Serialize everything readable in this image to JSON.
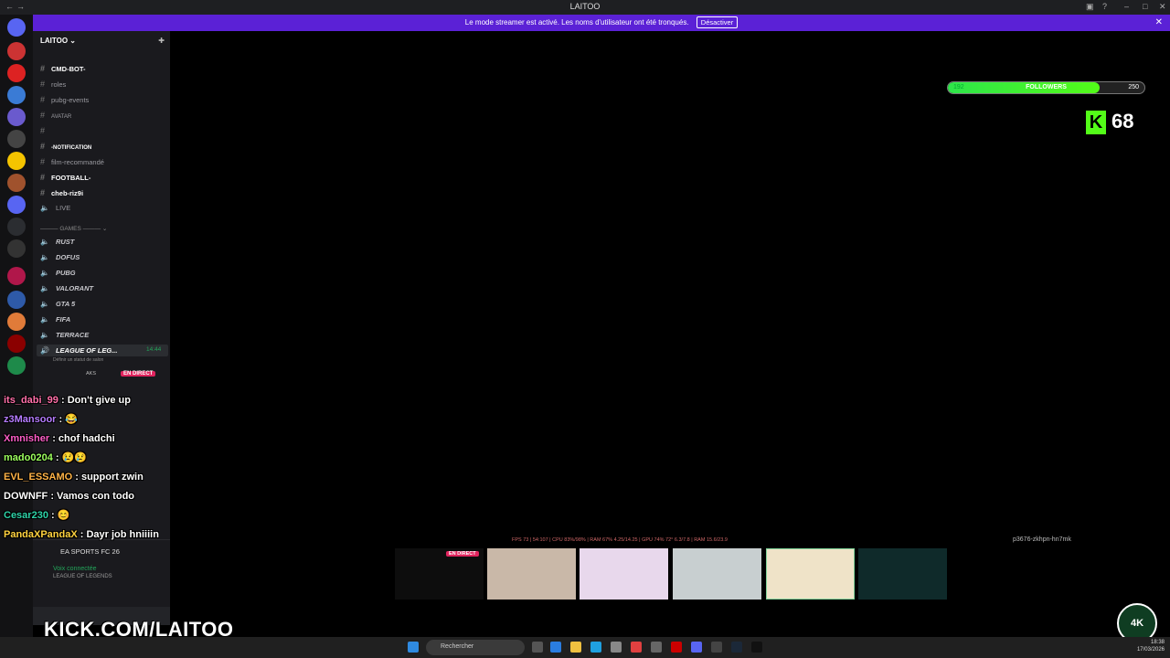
{
  "window": {
    "title": "LAITOO"
  },
  "banner": {
    "text": "Le mode streamer est activé. Les noms d'utilisateur ont été tronqués.",
    "button": "Désactiver",
    "close": "✕"
  },
  "server": {
    "name": "LAITOO"
  },
  "channels": [
    {
      "type": "text",
      "name": "CMD-BOT-",
      "bold": true
    },
    {
      "type": "text",
      "name": "roles"
    },
    {
      "type": "text",
      "name": "pubg-events"
    },
    {
      "type": "text",
      "name": "AVATAR"
    },
    {
      "type": "text",
      "name": ""
    },
    {
      "type": "text",
      "name": "-NOTIFICATION",
      "bold": true
    },
    {
      "type": "text",
      "name": "film-recommandé"
    },
    {
      "type": "text",
      "name": "FOOTBALL-",
      "bold": true
    },
    {
      "type": "text",
      "name": "cheb-riz9i",
      "bold": true
    },
    {
      "type": "voice",
      "name": "LIVE"
    }
  ],
  "category": {
    "name": "GAMES"
  },
  "voice_channels": [
    {
      "name": "RUST"
    },
    {
      "name": "DOFUS"
    },
    {
      "name": "PUBG"
    },
    {
      "name": "VALORANT"
    },
    {
      "name": "GTA 5"
    },
    {
      "name": "FIFA"
    },
    {
      "name": "TERRACE"
    }
  ],
  "active_voice": {
    "name": "LEAGUE OF LEG...",
    "timer": "14:44",
    "status": "Définir un statut de salon",
    "live_badge": "EN DIRECT",
    "member": "AKS"
  },
  "chat": [
    {
      "user": "its_dabi_99",
      "color": "#ff6fa8",
      "text": ": Don't give up"
    },
    {
      "user": "z3Mansoor",
      "color": "#b57cff",
      "text": ": 😂"
    },
    {
      "user": "Xmnisher",
      "color": "#ff5ec8",
      "text": ": chof hadchi"
    },
    {
      "user": "mado0204",
      "color": "#9dff5e",
      "text": ": 😢😢"
    },
    {
      "user": "EVL_ESSAMO",
      "color": "#ffb347",
      "text": ": support zwin"
    },
    {
      "user": "DOWNFF",
      "color": "#ffffff",
      "text": ": Vamos con todo"
    },
    {
      "user": "Cesar230",
      "color": "#2ed3a8",
      "text": ": 😊"
    },
    {
      "user": "PandaXPandaX",
      "color": "#ffd23f",
      "text": ": Dayr job hniiiin"
    }
  ],
  "activity": {
    "game": "EA SPORTS FC 26"
  },
  "voice_status": {
    "connected": "Voix connectée",
    "channel": "LEAGUE OF LEGENDS"
  },
  "followers": {
    "current": "192",
    "label": "FOLLOWERS",
    "goal": "250",
    "progress": 0.77
  },
  "viewers": {
    "count": "68"
  },
  "stats": {
    "text": "FPS 73  |  54:107  |  CPU 83%/98%  |  RAM 67%  4.25/14.25  |  GPU 74%  72°  6.3/7.8  |  RAM 15.6/23.9"
  },
  "stream_key": "p3676-zkhpn-hn7mk",
  "webcam": {
    "live_badge": "EN DIRECT"
  },
  "kick_url": "KICK.COM/LAITOO",
  "logo": {
    "text": "4K"
  },
  "taskbar": {
    "search": "Rechercher",
    "time": "18:38",
    "date": "17/03/2026"
  }
}
